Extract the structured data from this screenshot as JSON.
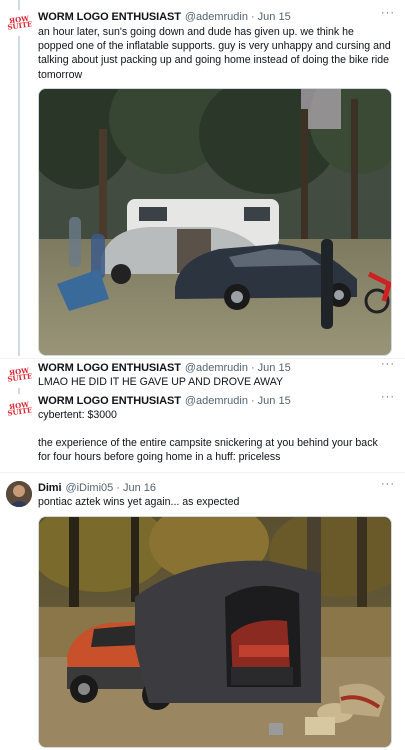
{
  "tweets": [
    {
      "name": "WORM LOGO ENTHUSIAST",
      "handle": "@ademrudin",
      "date": "Jun 15",
      "text": "an hour later, sun's going down and dude has given up. we think he popped one of the inflatable supports. guy is very unhappy and cursing and talking about just packing up and going home instead of doing the bike ride tomorrow",
      "more": "···"
    },
    {
      "name": "WORM LOGO ENTHUSIAST",
      "handle": "@ademrudin",
      "date": "Jun 15",
      "text": "LMAO HE DID IT HE GAVE UP AND DROVE AWAY",
      "more": "···"
    },
    {
      "name": "WORM LOGO ENTHUSIAST",
      "handle": "@ademrudin",
      "date": "Jun 15",
      "text_line1": "cybertent: $3000",
      "text_line2": "the experience of the entire campsite snickering at you behind your back for four hours before going home in a huff: priceless",
      "more": "···"
    },
    {
      "name": "Dimi",
      "handle": "@iDimi05",
      "date": "Jun 16",
      "text": "pontiac aztek wins yet again... as expected",
      "more": "···"
    }
  ],
  "separator": "·",
  "avatar_logo": "ЯOW SUITE",
  "colors": {
    "text": "#0f1419",
    "secondary": "#536471",
    "thread_line": "#cfd9de",
    "logo_red": "#d9232e"
  }
}
